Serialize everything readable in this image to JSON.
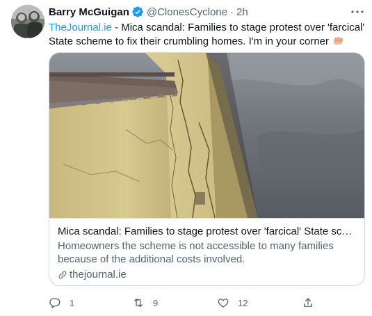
{
  "author": {
    "name": "Barry McGuigan",
    "handle": "@ClonesCyclone",
    "separator": "·",
    "time": "2h",
    "verified": true
  },
  "tweet": {
    "link_text": "TheJournal.ie",
    "body": " - Mica scandal: Families to stage protest over 'farcical' State scheme to fix their crumbling homes. I'm in your corner",
    "emoji": "fist-icon"
  },
  "card": {
    "title": "Mica scandal: Families to stage protest over 'farcical' State scheme to fi...",
    "description": "Homeowners the scheme is not accessible to many families because of the additional costs involved.",
    "domain": "thejournal.ie"
  },
  "actions": {
    "reply_count": "1",
    "retweet_count": "9",
    "like_count": "12"
  },
  "colors": {
    "accent": "#1d9bf0",
    "text": "#0f1419",
    "muted": "#536471",
    "border": "#cfd9de"
  }
}
